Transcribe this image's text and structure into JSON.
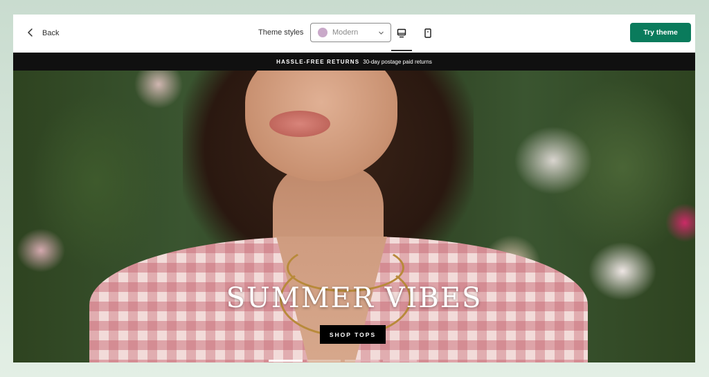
{
  "topbar": {
    "back_label": "Back",
    "theme_styles_label": "Theme styles",
    "theme_select": {
      "value": "Modern",
      "swatch_color": "#c9a9c9"
    },
    "device_toggle": {
      "selected": "desktop",
      "options": [
        "desktop-icon",
        "mobile-icon"
      ]
    },
    "try_button_label": "Try theme",
    "try_button_color": "#0a7b5c"
  },
  "announcement": {
    "strong_text": "HASSLE-FREE RETURNS",
    "text": "30-day postage paid returns"
  },
  "hero": {
    "title": "SUMMER VIBES",
    "button_label": "SHOP TOPS",
    "slides": {
      "count": 4,
      "active": 1
    }
  }
}
